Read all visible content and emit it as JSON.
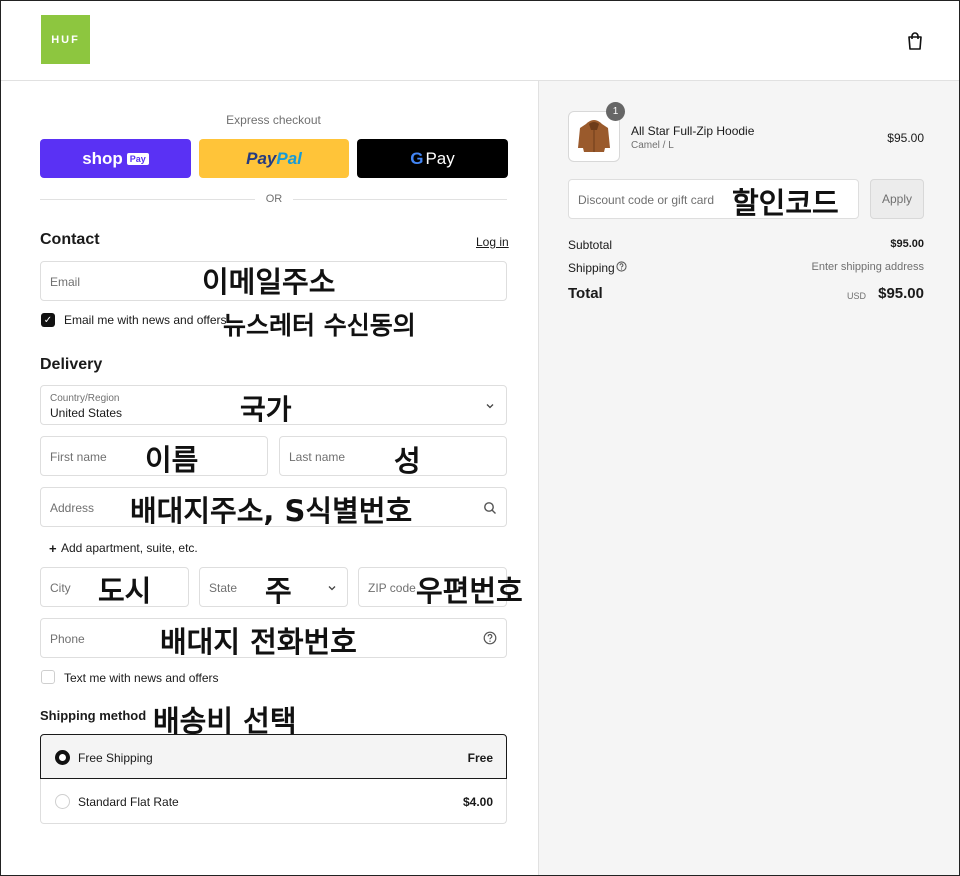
{
  "header": {
    "logo_text": "HUF",
    "bag_icon": "shopping-bag-icon"
  },
  "express": {
    "title": "Express checkout",
    "shop_label": "shop",
    "shop_badge": "Pay",
    "paypal_pay": "Pay",
    "paypal_pal": "Pal",
    "gpay_g": "G",
    "gpay_label": "Pay",
    "or": "OR"
  },
  "contact": {
    "title": "Contact",
    "login": "Log in",
    "email_placeholder": "Email",
    "email_annotation": "이메일주소",
    "news_label": "Email me with news and offers",
    "news_checked": true,
    "news_annotation": "뉴스레터 수신동의"
  },
  "delivery": {
    "title": "Delivery",
    "country_label": "Country/Region",
    "country_value": "United States",
    "country_annotation": "국가",
    "first_name": "First name",
    "first_name_annotation": "이름",
    "last_name": "Last name",
    "last_name_annotation": "성",
    "address": "Address",
    "address_annotation": "배대지주소, S식별번호",
    "add_apartment": "Add apartment, suite, etc.",
    "city": "City",
    "city_annotation": "도시",
    "state": "State",
    "state_annotation": "주",
    "zip": "ZIP code",
    "zip_annotation": "우편번호",
    "phone": "Phone",
    "phone_annotation": "배대지 전화번호",
    "text_label": "Text me with news and offers",
    "text_checked": false
  },
  "shipping": {
    "title": "Shipping method",
    "annotation": "배송비 선택",
    "options": [
      {
        "label": "Free Shipping",
        "price": "Free",
        "selected": true
      },
      {
        "label": "Standard Flat Rate",
        "price": "$4.00",
        "selected": false
      }
    ]
  },
  "summary": {
    "item_name": "All Star Full-Zip Hoodie",
    "item_variant": "Camel / L",
    "item_price": "$95.00",
    "item_qty": "1",
    "discount_placeholder": "Discount code or gift card",
    "discount_annotation": "할인코드",
    "apply": "Apply",
    "subtotal_label": "Subtotal",
    "subtotal_value": "$95.00",
    "shipping_label": "Shipping",
    "shipping_value": "Enter shipping address",
    "total_label": "Total",
    "currency": "USD",
    "total_value": "$95.00"
  }
}
